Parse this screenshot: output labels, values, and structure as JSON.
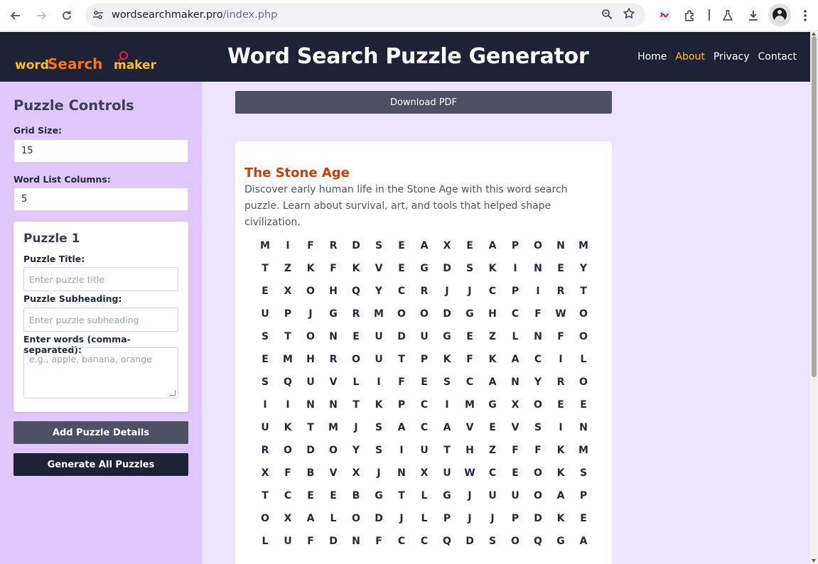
{
  "browser": {
    "back_icon": "arrow-left-icon",
    "forward_icon": "arrow-right-icon",
    "reload_icon": "reload-icon",
    "url_domain": "wordsearchmaker.pro",
    "url_path": "/index.php"
  },
  "header": {
    "logo_text": "wordSearchmaker",
    "title": "Word Search Puzzle Generator",
    "nav": [
      {
        "label": "Home"
      },
      {
        "label": "About"
      },
      {
        "label": "Privacy"
      },
      {
        "label": "Contact"
      }
    ],
    "active_nav": "About",
    "accent_color": "#fbbf24"
  },
  "sidebar": {
    "title": "Puzzle Controls",
    "grid_size_label": "Grid Size:",
    "grid_size_value": "15",
    "word_list_columns_label": "Word List Columns:",
    "word_list_columns_value": "5",
    "puzzle": {
      "title": "Puzzle 1",
      "title_label": "Puzzle Title:",
      "title_placeholder": "Enter puzzle title",
      "subheading_label": "Puzzle Subheading:",
      "subheading_placeholder": "Enter puzzle subheading",
      "words_label": "Enter words (comma-separated):",
      "words_placeholder": "e.g., apple, banana, orange"
    },
    "add_details_label": "Add Puzzle Details",
    "generate_label": "Generate All Puzzles"
  },
  "main": {
    "download_label": "Download PDF",
    "puzzle_title": "The Stone Age",
    "puzzle_subtitle": "Discover early human life in the Stone Age with this word search puzzle. Learn about survival, art, and tools that helped shape civilization.",
    "title_color": "#c2410c",
    "grid": [
      [
        "M",
        "I",
        "F",
        "R",
        "D",
        "S",
        "E",
        "A",
        "X",
        "E",
        "A",
        "P",
        "O",
        "N",
        "M"
      ],
      [
        "T",
        "Z",
        "K",
        "F",
        "K",
        "V",
        "E",
        "G",
        "D",
        "S",
        "K",
        "I",
        "N",
        "E",
        "Y"
      ],
      [
        "E",
        "X",
        "O",
        "H",
        "Q",
        "Y",
        "C",
        "R",
        "J",
        "J",
        "C",
        "P",
        "I",
        "R",
        "T"
      ],
      [
        "U",
        "P",
        "J",
        "G",
        "R",
        "M",
        "O",
        "O",
        "D",
        "G",
        "H",
        "C",
        "F",
        "W",
        "O"
      ],
      [
        "S",
        "T",
        "O",
        "N",
        "E",
        "U",
        "D",
        "U",
        "G",
        "E",
        "Z",
        "L",
        "N",
        "F",
        "O"
      ],
      [
        "E",
        "M",
        "H",
        "R",
        "O",
        "U",
        "T",
        "P",
        "K",
        "F",
        "K",
        "A",
        "C",
        "I",
        "L"
      ],
      [
        "S",
        "Q",
        "U",
        "V",
        "L",
        "I",
        "F",
        "E",
        "S",
        "C",
        "A",
        "N",
        "Y",
        "R",
        "O"
      ],
      [
        "I",
        "I",
        "N",
        "N",
        "T",
        "K",
        "P",
        "C",
        "I",
        "M",
        "G",
        "X",
        "O",
        "E",
        "E"
      ],
      [
        "U",
        "K",
        "T",
        "M",
        "J",
        "S",
        "A",
        "C",
        "A",
        "V",
        "E",
        "V",
        "S",
        "I",
        "N"
      ],
      [
        "R",
        "O",
        "D",
        "O",
        "Y",
        "S",
        "I",
        "U",
        "T",
        "H",
        "Z",
        "F",
        "F",
        "K",
        "M"
      ],
      [
        "X",
        "F",
        "B",
        "V",
        "X",
        "J",
        "N",
        "X",
        "U",
        "W",
        "C",
        "E",
        "O",
        "K",
        "S"
      ],
      [
        "T",
        "C",
        "E",
        "E",
        "B",
        "G",
        "T",
        "L",
        "G",
        "J",
        "U",
        "U",
        "O",
        "A",
        "P"
      ],
      [
        "O",
        "X",
        "A",
        "L",
        "O",
        "D",
        "J",
        "L",
        "P",
        "J",
        "J",
        "P",
        "D",
        "K",
        "E"
      ],
      [
        "L",
        "U",
        "F",
        "D",
        "N",
        "F",
        "C",
        "C",
        "Q",
        "D",
        "S",
        "O",
        "Q",
        "G",
        "A"
      ]
    ]
  }
}
